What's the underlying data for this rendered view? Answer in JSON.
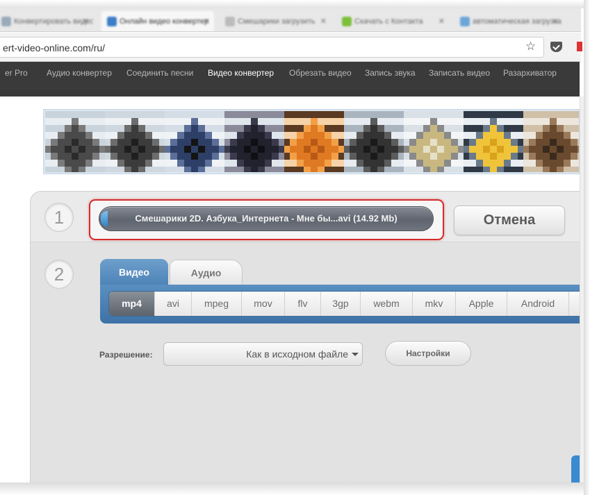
{
  "browser": {
    "tabs": [
      {
        "label": "Конвертировать видео"
      },
      {
        "label": "Онлайн видео конвертер"
      },
      {
        "label": "Смешарики загрузить"
      },
      {
        "label": "Скачать с Контакта"
      },
      {
        "label": "автоматическая загрузка"
      }
    ],
    "url": "ert-video-online.com/ru/"
  },
  "sitenav": {
    "items": [
      {
        "label": "er Pro"
      },
      {
        "label": "Аудио конвертер"
      },
      {
        "label": "Соединить песни"
      },
      {
        "label": "Видео конвертер"
      },
      {
        "label": "Обрезать видео"
      },
      {
        "label": "Запись звука"
      },
      {
        "label": "Записать видео"
      },
      {
        "label": "Разархиватор"
      }
    ]
  },
  "converter": {
    "step1": "1",
    "step2": "2",
    "file_name": "Смешарики 2D. Азбука_Интернета - Мне бы...avi (14.92 Mb)",
    "cancel": "Отмена",
    "tabs": {
      "video": "Видео",
      "audio": "Аудио"
    },
    "formats": [
      "mp4",
      "avi",
      "mpeg",
      "mov",
      "flv",
      "3gp",
      "webm",
      "mkv",
      "Apple",
      "Android"
    ],
    "selected_format": "mp4",
    "resolution_label": "Разрешение:",
    "resolution_value": "Как в исходном файле",
    "settings": "Настройки"
  },
  "colors": {
    "accent_blue": "#4d83b7",
    "highlight_red": "#d42b2b",
    "nav_bg": "#3a3a3a"
  }
}
